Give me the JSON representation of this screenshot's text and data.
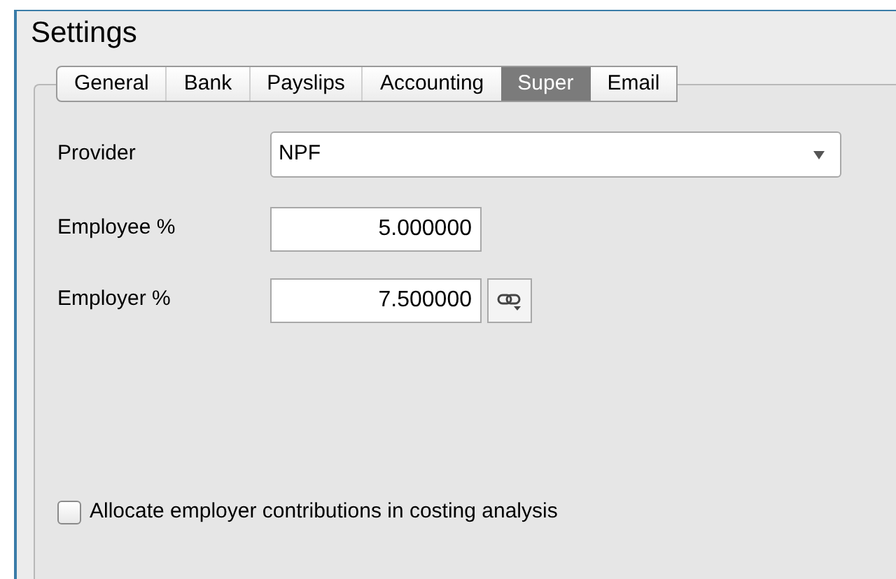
{
  "window": {
    "title": "Settings"
  },
  "tabs": [
    {
      "label": "General",
      "selected": false
    },
    {
      "label": "Bank",
      "selected": false
    },
    {
      "label": "Payslips",
      "selected": false
    },
    {
      "label": "Accounting",
      "selected": false
    },
    {
      "label": "Super",
      "selected": true
    },
    {
      "label": "Email",
      "selected": false
    }
  ],
  "form": {
    "provider": {
      "label": "Provider",
      "value": "NPF"
    },
    "employee": {
      "label": "Employee %",
      "value": "5.000000"
    },
    "employer": {
      "label": "Employer %",
      "value": "7.500000"
    }
  },
  "allocate": {
    "label": "Allocate employer contributions in costing analysis",
    "checked": false
  }
}
